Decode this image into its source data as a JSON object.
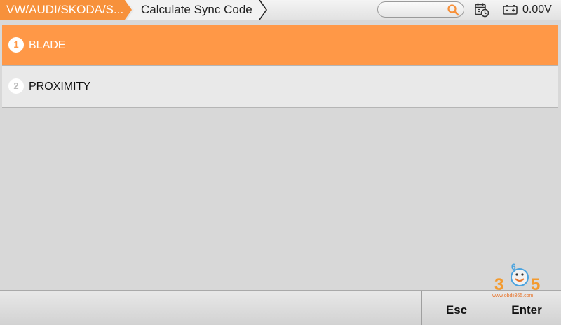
{
  "breadcrumb": {
    "items": [
      {
        "label": "VW/AUDI/SKODA/S..."
      },
      {
        "label": "Calculate Sync Code"
      }
    ]
  },
  "search": {
    "value": "",
    "placeholder": ""
  },
  "status": {
    "voltage": "0.00V"
  },
  "list": {
    "items": [
      {
        "number": "1",
        "label": "BLADE",
        "selected": true
      },
      {
        "number": "2",
        "label": "PROXIMITY",
        "selected": false
      }
    ]
  },
  "footer": {
    "esc_label": "Esc",
    "enter_label": "Enter"
  },
  "watermark": {
    "digit_1": "3",
    "digit_2": "6",
    "digit_3": "5",
    "url": "www.obdii365.com"
  },
  "colors": {
    "accent": "#f7913b",
    "selected_row": "#ff9847",
    "background": "#d8d8d8"
  },
  "icons": [
    "search-icon",
    "calendar-clock-icon",
    "battery-icon"
  ]
}
